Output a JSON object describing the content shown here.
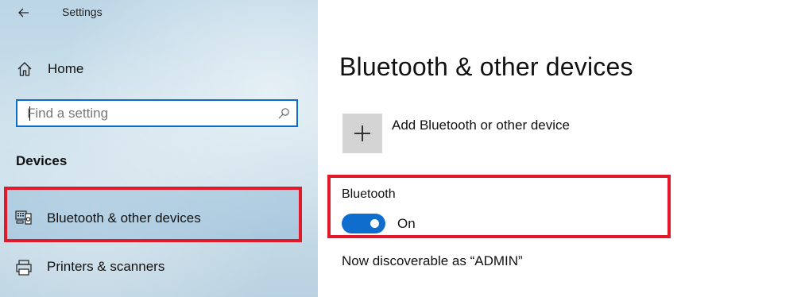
{
  "app": {
    "title": "Settings"
  },
  "sidebar": {
    "home_label": "Home",
    "search": {
      "placeholder": "Find a setting",
      "value": ""
    },
    "section_header": "Devices",
    "items": [
      {
        "label": "Bluetooth & other devices",
        "icon": "bluetooth-devices-icon",
        "selected": true
      },
      {
        "label": "Printers & scanners",
        "icon": "printer-icon",
        "selected": false
      }
    ]
  },
  "main": {
    "title": "Bluetooth & other devices",
    "add_device_label": "Add Bluetooth or other device",
    "bluetooth": {
      "label": "Bluetooth",
      "state": "On",
      "enabled": true
    },
    "discoverable_text": "Now discoverable as “ADMIN”"
  },
  "colors": {
    "accent": "#0f6ecd",
    "highlight_box": "#e01a2b",
    "search_border": "#0a6ec8"
  }
}
